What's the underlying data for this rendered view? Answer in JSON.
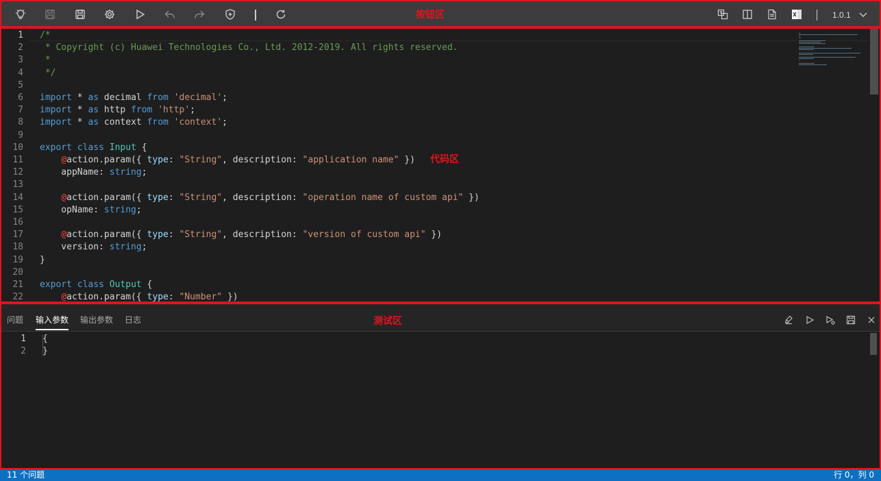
{
  "toolbar": {
    "region_label": "按钮区",
    "version": "1.0.1",
    "icons": [
      "lightbulb-icon",
      "save-outline-icon",
      "save-icon",
      "gear-icon",
      "play-icon",
      "undo-icon",
      "redo-icon",
      "shield-icon",
      "refresh-icon",
      "translate-icon",
      "split-view-icon",
      "document-icon",
      "excel-icon",
      "chevron-down-icon"
    ]
  },
  "editor": {
    "region_label": "代码区",
    "lines": [
      {
        "n": "1",
        "tokens": [
          [
            "t-comment",
            "/*"
          ]
        ]
      },
      {
        "n": "2",
        "tokens": [
          [
            "t-comment",
            " * Copyright (c) Huawei Technologies Co., Ltd. 2012-2019. All rights reserved."
          ]
        ]
      },
      {
        "n": "3",
        "tokens": [
          [
            "t-comment",
            " *"
          ]
        ]
      },
      {
        "n": "4",
        "tokens": [
          [
            "t-comment",
            " */"
          ]
        ]
      },
      {
        "n": "5",
        "tokens": []
      },
      {
        "n": "6",
        "tokens": [
          [
            "t-kw",
            "import"
          ],
          [
            "t-def",
            " * "
          ],
          [
            "t-kw",
            "as"
          ],
          [
            "t-def",
            " decimal "
          ],
          [
            "t-kw",
            "from"
          ],
          [
            "t-def",
            " "
          ],
          [
            "t-str",
            "'decimal'"
          ],
          [
            "t-def",
            ";"
          ]
        ]
      },
      {
        "n": "7",
        "tokens": [
          [
            "t-kw",
            "import"
          ],
          [
            "t-def",
            " * "
          ],
          [
            "t-kw",
            "as"
          ],
          [
            "t-def",
            " http "
          ],
          [
            "t-kw",
            "from"
          ],
          [
            "t-def",
            " "
          ],
          [
            "t-str",
            "'http'"
          ],
          [
            "t-def",
            ";"
          ]
        ]
      },
      {
        "n": "8",
        "tokens": [
          [
            "t-kw",
            "import"
          ],
          [
            "t-def",
            " * "
          ],
          [
            "t-kw",
            "as"
          ],
          [
            "t-def",
            " context "
          ],
          [
            "t-kw",
            "from"
          ],
          [
            "t-def",
            " "
          ],
          [
            "t-str",
            "'context'"
          ],
          [
            "t-def",
            ";"
          ]
        ]
      },
      {
        "n": "9",
        "tokens": []
      },
      {
        "n": "10",
        "tokens": [
          [
            "t-kw",
            "export"
          ],
          [
            "t-def",
            " "
          ],
          [
            "t-kw",
            "class"
          ],
          [
            "t-def",
            " "
          ],
          [
            "t-cls",
            "Input"
          ],
          [
            "t-def",
            " {"
          ]
        ]
      },
      {
        "n": "11",
        "tokens": [
          [
            "t-def",
            "    "
          ],
          [
            "t-dec",
            "@"
          ],
          [
            "t-def",
            "action.param({ "
          ],
          [
            "t-prop",
            "type"
          ],
          [
            "t-def",
            ": "
          ],
          [
            "t-str",
            "\"String\""
          ],
          [
            "t-def",
            ", description: "
          ],
          [
            "t-str",
            "\"application name\""
          ],
          [
            "t-def",
            " })"
          ]
        ]
      },
      {
        "n": "12",
        "tokens": [
          [
            "t-def",
            "    appName: "
          ],
          [
            "t-kw",
            "string"
          ],
          [
            "t-def",
            ";"
          ]
        ]
      },
      {
        "n": "13",
        "tokens": []
      },
      {
        "n": "14",
        "tokens": [
          [
            "t-def",
            "    "
          ],
          [
            "t-dec",
            "@"
          ],
          [
            "t-def",
            "action.param({ "
          ],
          [
            "t-prop",
            "type"
          ],
          [
            "t-def",
            ": "
          ],
          [
            "t-str",
            "\"String\""
          ],
          [
            "t-def",
            ", description: "
          ],
          [
            "t-str",
            "\"operation name of custom api\""
          ],
          [
            "t-def",
            " })"
          ]
        ]
      },
      {
        "n": "15",
        "tokens": [
          [
            "t-def",
            "    opName: "
          ],
          [
            "t-kw",
            "string"
          ],
          [
            "t-def",
            ";"
          ]
        ]
      },
      {
        "n": "16",
        "tokens": []
      },
      {
        "n": "17",
        "tokens": [
          [
            "t-def",
            "    "
          ],
          [
            "t-dec",
            "@"
          ],
          [
            "t-def",
            "action.param({ "
          ],
          [
            "t-prop",
            "type"
          ],
          [
            "t-def",
            ": "
          ],
          [
            "t-str",
            "\"String\""
          ],
          [
            "t-def",
            ", description: "
          ],
          [
            "t-str",
            "\"version of custom api\""
          ],
          [
            "t-def",
            " })"
          ]
        ]
      },
      {
        "n": "18",
        "tokens": [
          [
            "t-def",
            "    version: "
          ],
          [
            "t-kw",
            "string"
          ],
          [
            "t-def",
            ";"
          ]
        ]
      },
      {
        "n": "19",
        "tokens": [
          [
            "t-def",
            "}"
          ]
        ]
      },
      {
        "n": "20",
        "tokens": []
      },
      {
        "n": "21",
        "tokens": [
          [
            "t-kw",
            "export"
          ],
          [
            "t-def",
            " "
          ],
          [
            "t-kw",
            "class"
          ],
          [
            "t-def",
            " "
          ],
          [
            "t-cls",
            "Output"
          ],
          [
            "t-def",
            " {"
          ]
        ]
      },
      {
        "n": "22",
        "tokens": [
          [
            "t-def",
            "    "
          ],
          [
            "t-dec",
            "@"
          ],
          [
            "t-def",
            "action.param({ "
          ],
          [
            "t-prop",
            "type"
          ],
          [
            "t-def",
            ": "
          ],
          [
            "t-str",
            "\"Number\""
          ],
          [
            "t-def",
            " })"
          ]
        ]
      }
    ]
  },
  "test": {
    "region_label": "测试区",
    "tabs": [
      {
        "label": "问题",
        "active": false
      },
      {
        "label": "输入参数",
        "active": true
      },
      {
        "label": "输出参数",
        "active": false
      },
      {
        "label": "日志",
        "active": false
      }
    ],
    "lines": [
      {
        "n": "1",
        "text": "{"
      },
      {
        "n": "2",
        "text": "}"
      }
    ],
    "icons": [
      "clear-icon",
      "run-icon",
      "debug-run-icon",
      "save-icon",
      "close-icon"
    ]
  },
  "status": {
    "problems": "11 个问题",
    "position": "行 0，列 0"
  },
  "colors": {
    "region_border": "#e0141e",
    "status_bg": "#0e70c0",
    "toolbar_bg": "#3c3c3c"
  }
}
